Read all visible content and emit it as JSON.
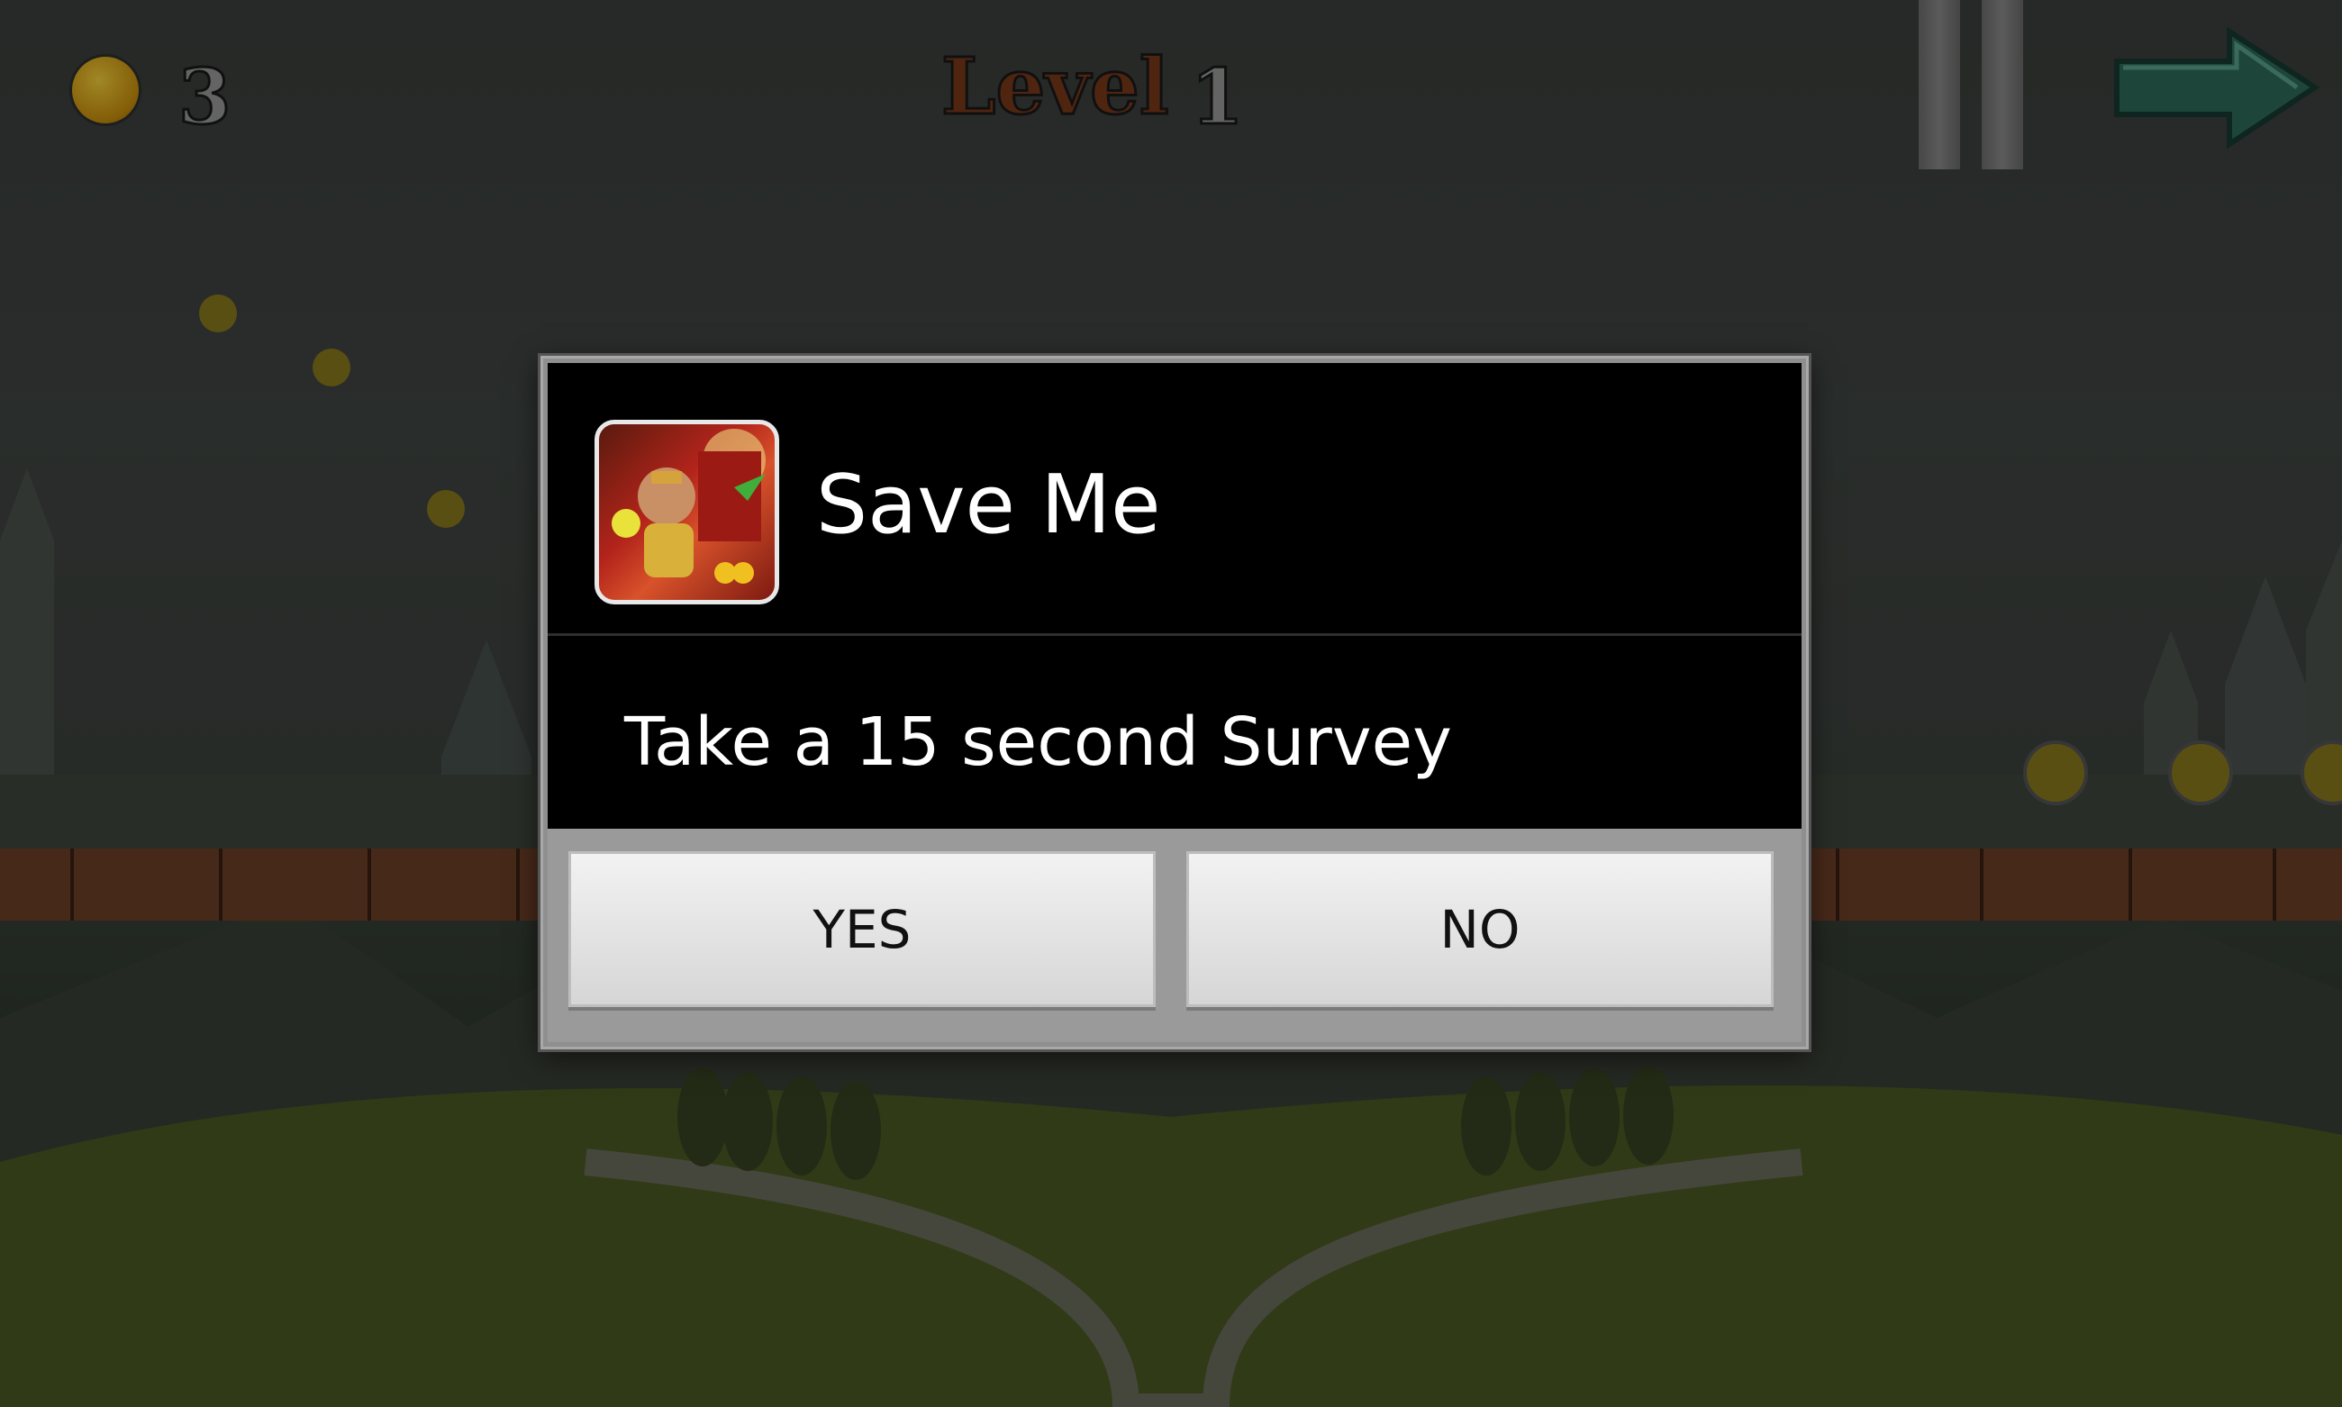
{
  "hud": {
    "coin_count": "3",
    "level_label": "Level",
    "level_number": "1",
    "pause_icon": "pause-icon",
    "next_icon": "arrow-right-icon"
  },
  "dialog": {
    "title": "Save Me",
    "message": "Take a 15 second Survey",
    "yes_label": "YES",
    "no_label": "NO",
    "app_icon": "app-icon"
  },
  "colors": {
    "level_label": "#7b3a1a",
    "dialog_background": "#000000",
    "button_bar": "#9a9a9a",
    "next_arrow": "#2e6b58"
  }
}
